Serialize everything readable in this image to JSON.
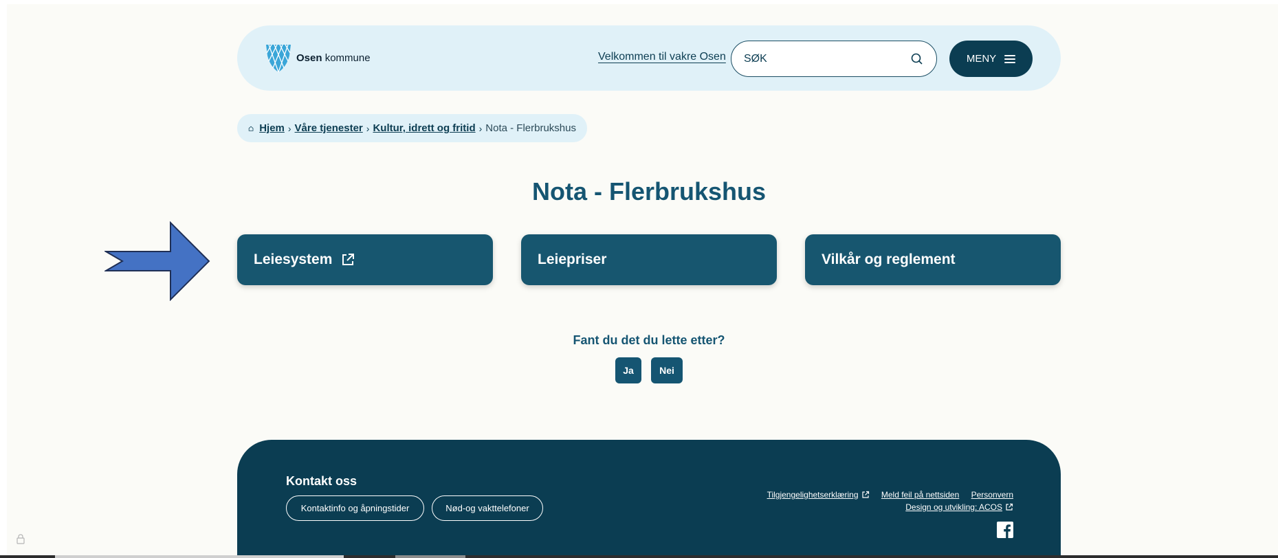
{
  "header": {
    "logo_brand": "Osen",
    "logo_suffix": "kommune",
    "welcome_link": "Velkommen til vakre Osen",
    "search": {
      "placeholder": "SØK"
    },
    "menu_label": "MENY"
  },
  "breadcrumb": {
    "items": [
      "Hjem",
      "Våre tjenester",
      "Kultur, idrett og fritid"
    ],
    "current": "Nota - Flerbrukshus"
  },
  "page": {
    "title": "Nota - Flerbrukshus",
    "cards": [
      {
        "label": "Leiesystem",
        "external": true
      },
      {
        "label": "Leiepriser",
        "external": false
      },
      {
        "label": "Vilkår og reglement",
        "external": false
      }
    ]
  },
  "feedback": {
    "question": "Fant du det du lette etter?",
    "yes": "Ja",
    "no": "Nei"
  },
  "footer": {
    "heading": "Kontakt oss",
    "pills": [
      "Kontaktinfo og åpningstider",
      "Nød-og vakttelefoner"
    ],
    "links": {
      "accessibility": "Tilgjengelighetserklæring",
      "report": "Meld feil på nettsiden",
      "privacy": "Personvern",
      "design": "Design og utvikling: ACOS"
    }
  },
  "colors": {
    "primary": "#17566f",
    "dark": "#0b3d52",
    "light_bg": "#e0f1f8",
    "arrow": "#4472c4"
  },
  "icons": [
    "search-icon",
    "hamburger-icon",
    "home-icon",
    "external-link-icon",
    "facebook-icon",
    "lock-icon",
    "arrow-right-icon"
  ]
}
